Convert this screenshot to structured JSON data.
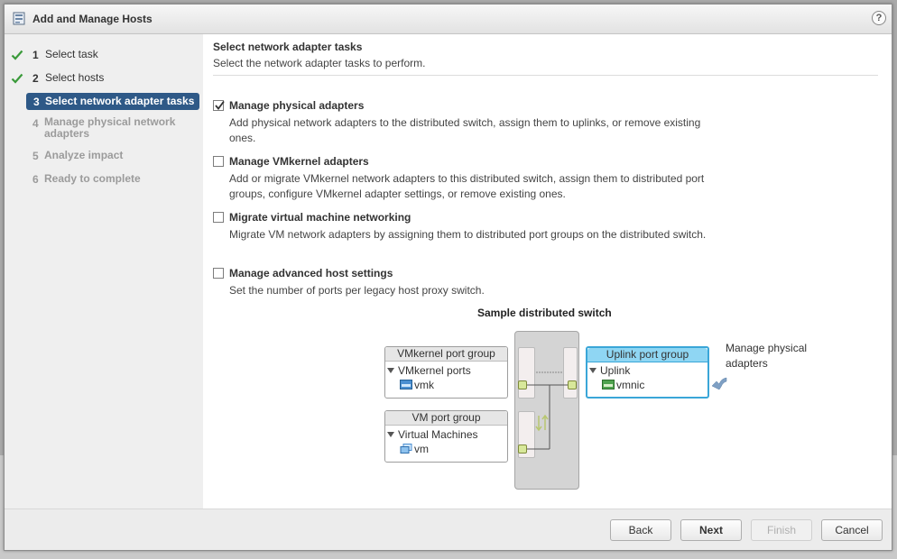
{
  "dialog": {
    "title": "Add and Manage Hosts",
    "help_icon": "?"
  },
  "steps": [
    {
      "num": "1",
      "label": "Select task",
      "state": "done"
    },
    {
      "num": "2",
      "label": "Select hosts",
      "state": "done"
    },
    {
      "num": "3",
      "label": "Select network adapter tasks",
      "state": "active"
    },
    {
      "num": "4",
      "label": "Manage physical network adapters",
      "state": "disabled"
    },
    {
      "num": "5",
      "label": "Analyze impact",
      "state": "disabled"
    },
    {
      "num": "6",
      "label": "Ready to complete",
      "state": "disabled"
    }
  ],
  "content": {
    "title": "Select network adapter tasks",
    "subtitle": "Select the network adapter tasks to perform."
  },
  "tasks": [
    {
      "label": "Manage physical adapters",
      "checked": true,
      "desc": "Add physical network adapters to the distributed switch, assign them to uplinks, or remove existing ones."
    },
    {
      "label": "Manage VMkernel adapters",
      "checked": false,
      "desc": "Add or migrate VMkernel network adapters to this distributed switch, assign them to distributed port groups, configure VMkernel adapter settings, or remove existing ones."
    },
    {
      "label": "Migrate virtual machine networking",
      "checked": false,
      "desc": "Migrate VM network adapters by assigning them to distributed port groups on the distributed switch."
    },
    {
      "label": "Manage advanced host settings",
      "checked": false,
      "desc": "Set the number of ports per legacy host proxy switch."
    }
  ],
  "diagram": {
    "title": "Sample distributed switch",
    "vmkernel_group": {
      "header": "VMkernel port group",
      "section": "VMkernel ports",
      "item": "vmk"
    },
    "vm_group": {
      "header": "VM port group",
      "section": "Virtual Machines",
      "item": "vm"
    },
    "uplink_group": {
      "header": "Uplink port group",
      "section": "Uplink",
      "item": "vmnic"
    },
    "note": "Manage physical adapters"
  },
  "buttons": {
    "back": "Back",
    "next": "Next",
    "finish": "Finish",
    "cancel": "Cancel"
  },
  "colors": {
    "active_step_bg": "#2e5987",
    "check_green": "#3a9a3a",
    "uplink_header": "#8fd6f3",
    "uplink_border": "#3aa6d8"
  }
}
